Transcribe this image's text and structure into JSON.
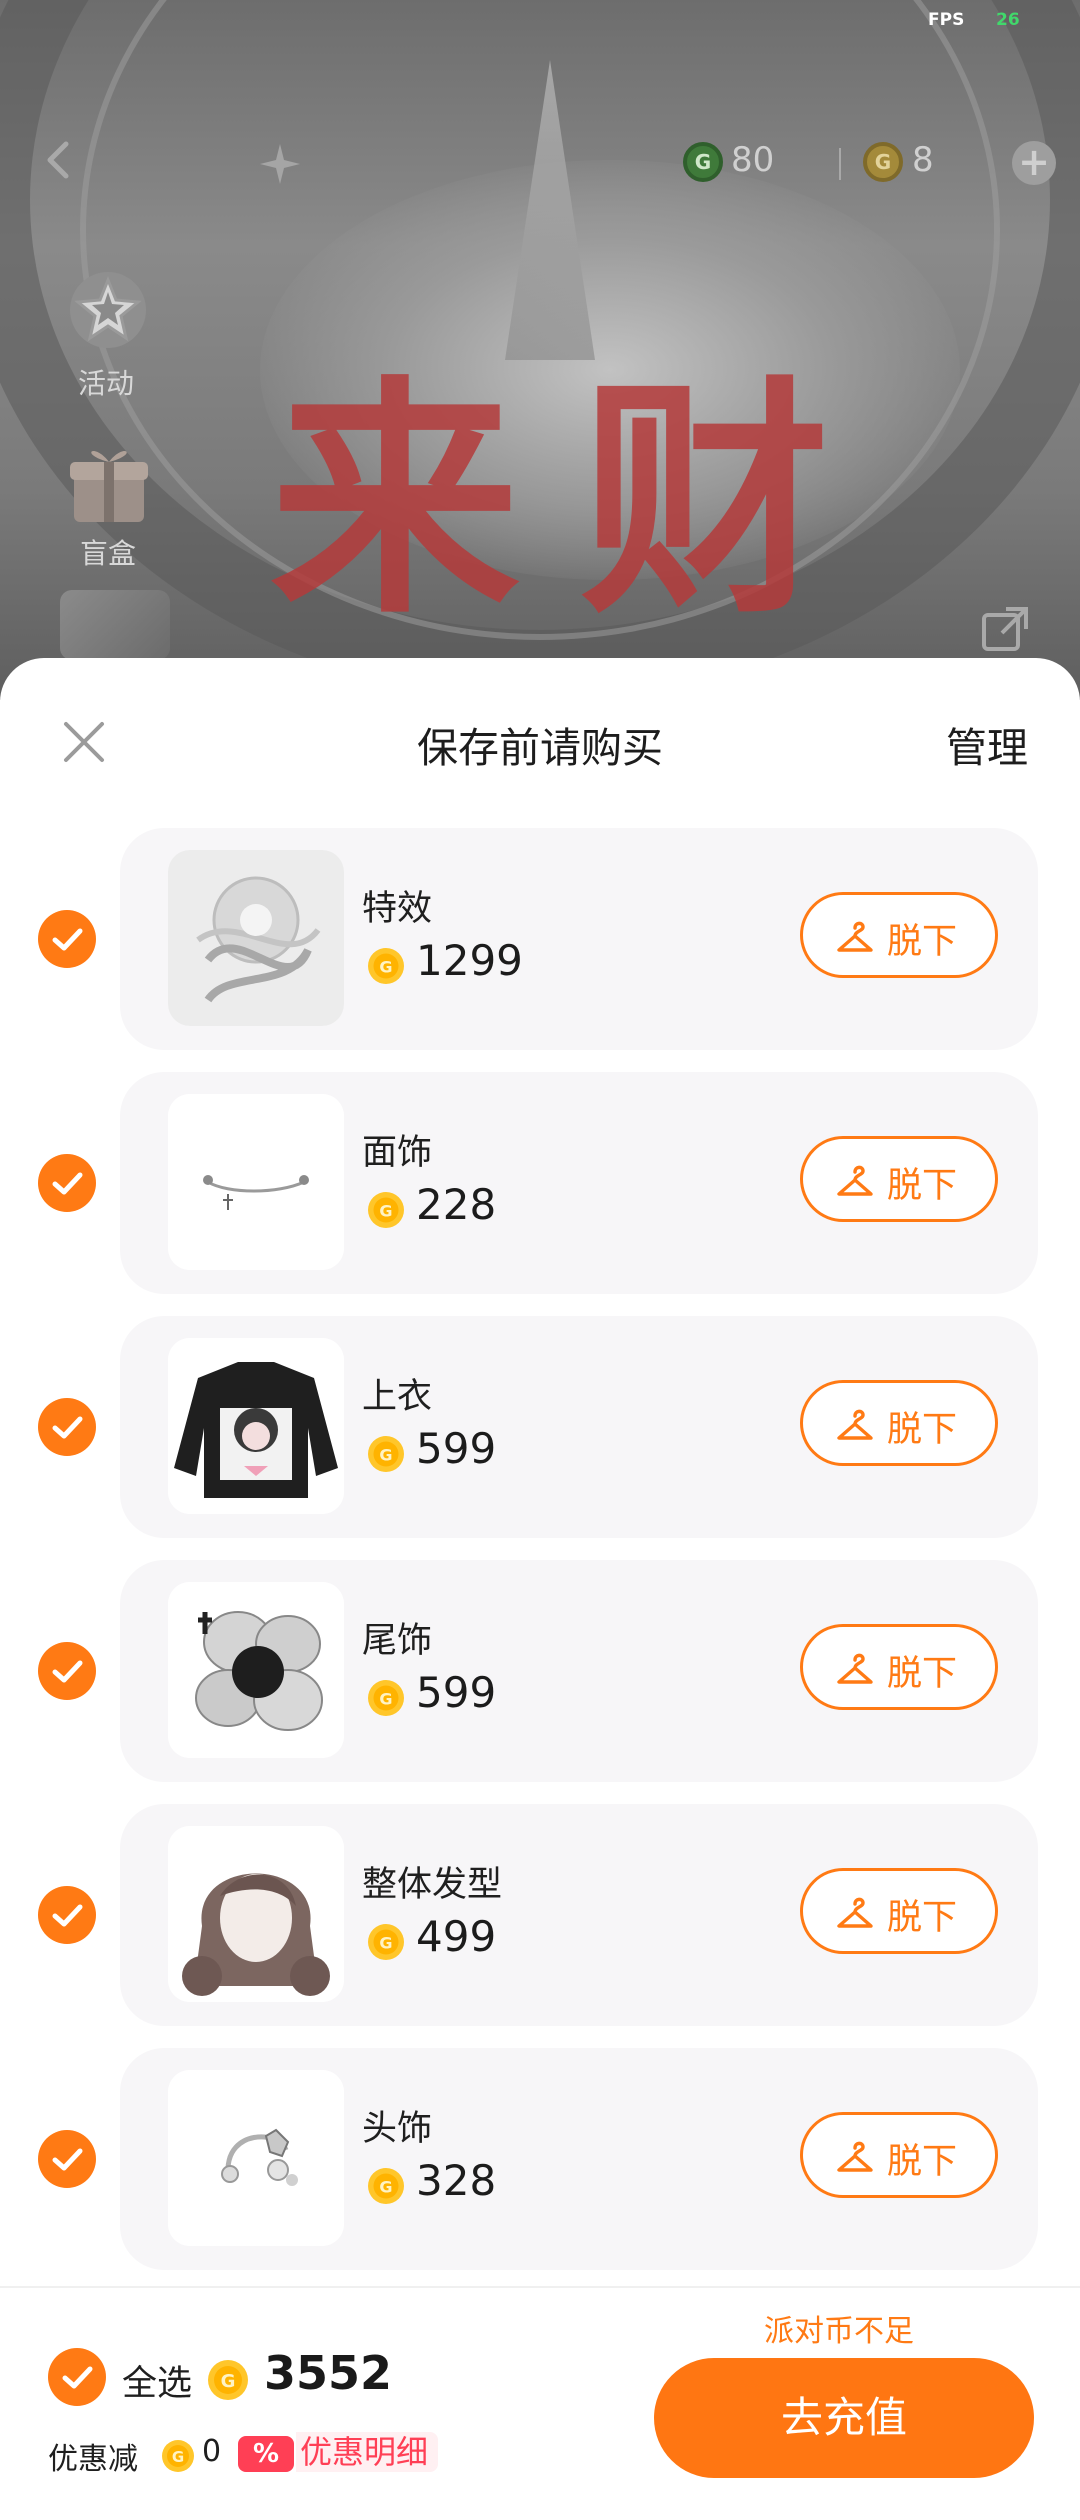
{
  "status": {
    "fps_label": "FPS",
    "fps_value": "26"
  },
  "currency": {
    "green_amount": "80",
    "gold_amount": "8"
  },
  "side": {
    "activity_label": "活动",
    "blindbox_label": "盲盒"
  },
  "banner": {
    "calligraphy": "来财"
  },
  "sheet": {
    "title": "保存前请购买",
    "manage_label": "管理"
  },
  "items": [
    {
      "name": "特效",
      "price": "1299",
      "action": "脱下",
      "thumb": "effect"
    },
    {
      "name": "面饰",
      "price": "228",
      "action": "脱下",
      "thumb": "face"
    },
    {
      "name": "上衣",
      "price": "599",
      "action": "脱下",
      "thumb": "top"
    },
    {
      "name": "尾饰",
      "price": "599",
      "action": "脱下",
      "thumb": "tail"
    },
    {
      "name": "整体发型",
      "price": "499",
      "action": "脱下",
      "thumb": "hair"
    },
    {
      "name": "头饰",
      "price": "328",
      "action": "脱下",
      "thumb": "headwear"
    }
  ],
  "footer": {
    "insufficient": "派对币不足",
    "select_all": "全选",
    "total": "3552",
    "discount_label": "优惠减",
    "discount_value": "0",
    "percent_icon": "%",
    "discount_detail": "优惠明细",
    "recharge": "去充值"
  },
  "colors": {
    "accent": "#ff7a14",
    "discount": "#ff3f55",
    "card": "#f7f6f8"
  }
}
